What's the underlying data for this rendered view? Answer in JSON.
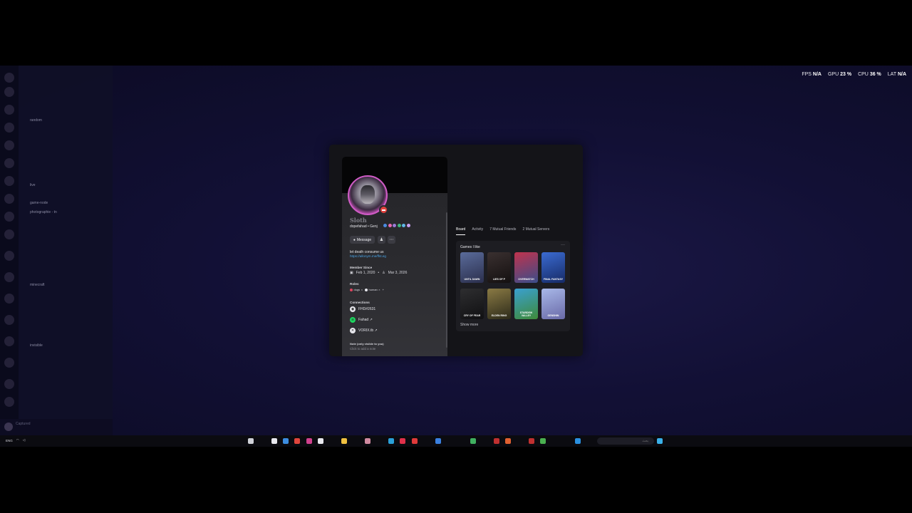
{
  "overlay": {
    "fps_label": "FPS",
    "fps_value": "N/A",
    "gpu_label": "GPU",
    "gpu_value": "23 %",
    "cpu_label": "CPU",
    "cpu_value": "36 %",
    "lat_label": "LAT",
    "lat_value": "N/A"
  },
  "profile": {
    "display_name": "Sloth",
    "username": "dopefahad • Genj",
    "message_label": "Message",
    "bio": "let death consume us",
    "link": "https://allonym.me/ffst.eg",
    "member_since_title": "Member Since",
    "discord_since": "Feb 1, 2020",
    "server_since": "Mar 3, 2026",
    "roles_title": "Roles",
    "roles": [
      {
        "name": "dogs",
        "color": "#e0455f"
      },
      {
        "name": "human",
        "color": "#e8e8ee"
      }
    ],
    "connections_title": "Connections",
    "connections": [
      {
        "name": "FHD#2631",
        "icon": "steam-icon"
      },
      {
        "name": "Fahad ↗",
        "icon": "spotify-icon"
      },
      {
        "name": "VORIX.tb ↗",
        "icon": "xbox-icon"
      }
    ],
    "note_title": "Note (only visible to you)",
    "note_placeholder": "Click to add a note"
  },
  "tabs": {
    "board": "Board",
    "activity": "Activity",
    "mutual_friends": "7 Mutual Friends",
    "mutual_servers": "2 Mutual Servers"
  },
  "games": {
    "title": "Games I like",
    "more": "···",
    "show_more": "Show more",
    "items": [
      {
        "label": "UNTIL DAWN",
        "colors": [
          "#5a6b9a",
          "#2b2f4d"
        ]
      },
      {
        "label": "LIES OF P",
        "colors": [
          "#3a3030",
          "#141010"
        ]
      },
      {
        "label": "OVERWATCH",
        "colors": [
          "#c0334d",
          "#3a4d8a"
        ]
      },
      {
        "label": "FINAL FANTASY",
        "colors": [
          "#3b6bd1",
          "#162a66"
        ]
      },
      {
        "label": "CRY OF FEAR",
        "colors": [
          "#2e2e30",
          "#101012"
        ]
      },
      {
        "label": "ELDEN RING",
        "colors": [
          "#8a7a44",
          "#2c2a1a"
        ]
      },
      {
        "label": "STARDEW VALLEY",
        "colors": [
          "#3aa0d0",
          "#3e8a3a"
        ]
      },
      {
        "label": "GENSHIN",
        "colors": [
          "#a8b8e8",
          "#6a6aa8"
        ]
      }
    ]
  },
  "taskbar": {
    "lang": "ENG",
    "search_placeholder": "بحث"
  }
}
